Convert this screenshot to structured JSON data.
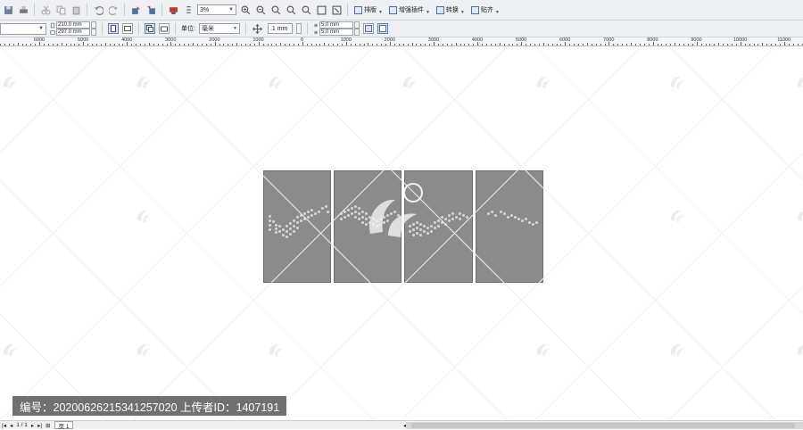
{
  "toolbar": {
    "zoom_value": "3%",
    "tools": [
      {
        "label": "排版",
        "icon": "layout-icon"
      },
      {
        "label": "增强插件",
        "icon": "plugin-icon"
      },
      {
        "label": "转换",
        "icon": "convert-icon"
      },
      {
        "label": "贴齐",
        "icon": "snap-icon"
      }
    ]
  },
  "property_bar": {
    "page_width": "210.0 mm",
    "page_height": "297.0 mm",
    "units_label": "单位:",
    "units_value": "毫米",
    "nudge_value": ".1 mm",
    "dup_x": "5.0 mm",
    "dup_y": "5.0 mm"
  },
  "ruler": {
    "labels": [
      "6000",
      "5000",
      "4000",
      "3000",
      "2000",
      "1000",
      "0",
      "1000",
      "2000",
      "3000",
      "4000",
      "5000",
      "6000",
      "7000",
      "8000",
      "9000",
      "10000",
      "11000"
    ]
  },
  "caption": {
    "text": "编号：20200626215341257020 上传者ID：1407191"
  },
  "status": {
    "page_count": "1 / 1",
    "page_tab": "页 1"
  },
  "colors": {
    "panel": "#8b8b8b",
    "toolbar": "#eef0f4"
  }
}
